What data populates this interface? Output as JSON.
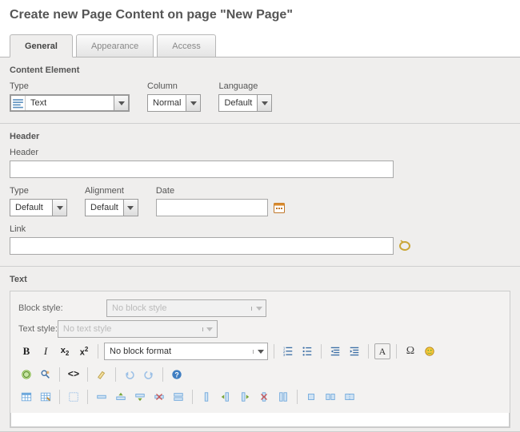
{
  "page_title": "Create new Page Content on page \"New Page\"",
  "tabs": {
    "general": "General",
    "appearance": "Appearance",
    "access": "Access"
  },
  "content_element": {
    "title": "Content Element",
    "type_label": "Type",
    "type_value": "Text",
    "column_label": "Column",
    "column_value": "Normal",
    "language_label": "Language",
    "language_value": "Default"
  },
  "header": {
    "title": "Header",
    "header_label": "Header",
    "header_value": "",
    "type_label": "Type",
    "type_value": "Default",
    "alignment_label": "Alignment",
    "alignment_value": "Default",
    "date_label": "Date",
    "date_value": "",
    "link_label": "Link",
    "link_value": ""
  },
  "text": {
    "title": "Text",
    "block_style_label": "Block style:",
    "block_style_value": "No block style",
    "text_style_label": "Text style:",
    "text_style_value": "No text style",
    "block_format_value": "No block format"
  }
}
